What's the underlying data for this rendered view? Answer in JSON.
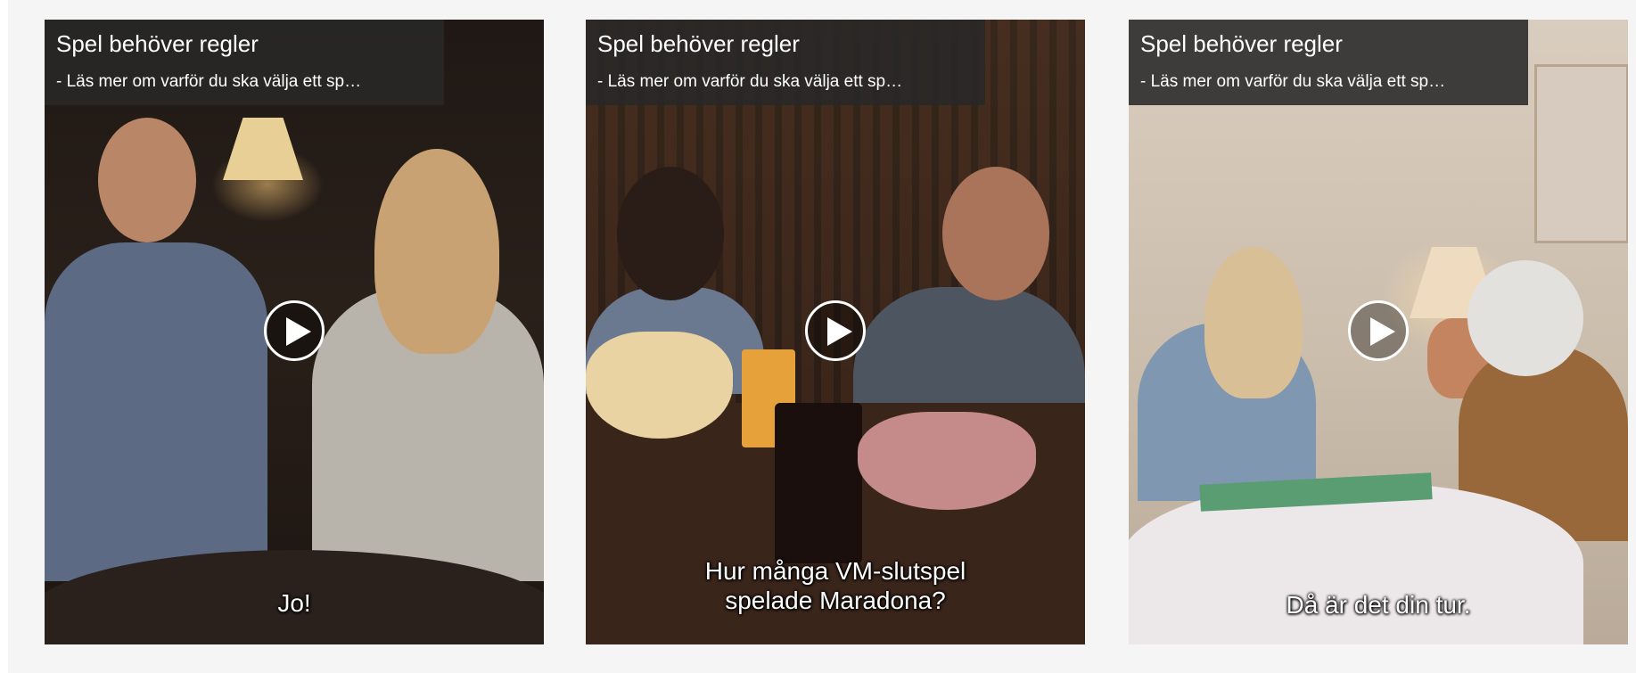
{
  "cards": [
    {
      "title": "Spel behöver regler",
      "description": "- Läs mer om varför du ska välja ett sp…",
      "subtitle": "Jo!",
      "play_icon": "play-icon"
    },
    {
      "title": "Spel behöver regler",
      "description": "- Läs mer om varför du ska välja ett sp…",
      "subtitle_line1": "Hur många VM-slutspel",
      "subtitle_line2": "spelade Maradona?",
      "play_icon": "play-icon"
    },
    {
      "title": "Spel behöver regler",
      "description": "- Läs mer om varför du ska välja ett sp…",
      "subtitle": "Då är det din tur.",
      "play_icon": "play-icon"
    }
  ],
  "colors": {
    "caption_background": "#282828",
    "page_panel": "#f5f5f5",
    "text": "#ffffff"
  }
}
